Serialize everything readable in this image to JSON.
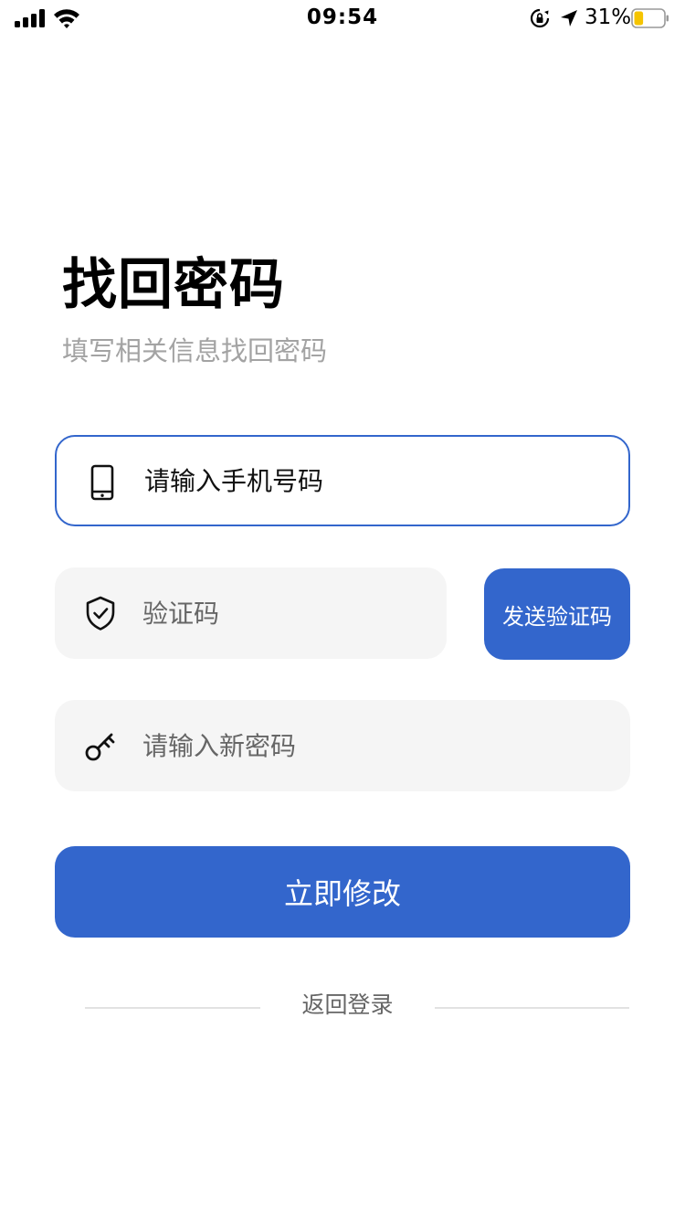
{
  "status_bar": {
    "time": "09:54",
    "battery_percent": "31%",
    "battery_level": 0.31,
    "battery_color": "#f5c400"
  },
  "header": {
    "title": "找回密码",
    "subtitle": "填写相关信息找回密码"
  },
  "form": {
    "phone": {
      "placeholder": "请输入手机号码",
      "icon": "phone-icon"
    },
    "code": {
      "placeholder": "验证码",
      "icon": "shield-check-icon",
      "send_button_label": "发送验证码"
    },
    "password": {
      "placeholder": "请输入新密码",
      "icon": "key-icon"
    },
    "submit_label": "立即修改"
  },
  "footer": {
    "back_label": "返回登录"
  },
  "colors": {
    "accent": "#3366cc",
    "input_background": "#f5f5f5",
    "subtitle_text": "#a3a3a3"
  }
}
